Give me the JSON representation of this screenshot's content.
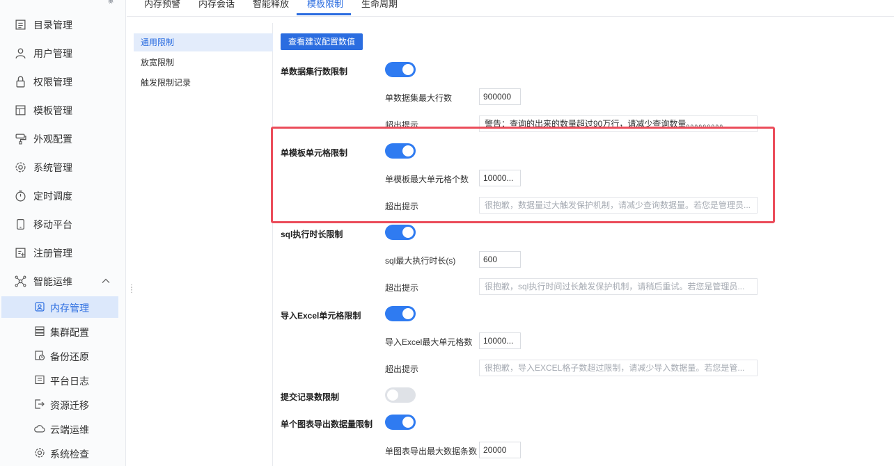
{
  "sidebar": {
    "items": [
      {
        "label": "目录管理",
        "icon": "catalog-icon"
      },
      {
        "label": "用户管理",
        "icon": "user-icon"
      },
      {
        "label": "权限管理",
        "icon": "lock-icon"
      },
      {
        "label": "模板管理",
        "icon": "template-icon"
      },
      {
        "label": "外观配置",
        "icon": "paint-roller-icon"
      },
      {
        "label": "系统管理",
        "icon": "gear-icon"
      },
      {
        "label": "定时调度",
        "icon": "timer-icon"
      },
      {
        "label": "移动平台",
        "icon": "mobile-icon"
      },
      {
        "label": "注册管理",
        "icon": "register-icon"
      },
      {
        "label": "智能运维",
        "icon": "network-icon"
      }
    ],
    "sub_items": [
      {
        "label": "内存管理",
        "icon": "memory-icon",
        "active": true
      },
      {
        "label": "集群配置",
        "icon": "cluster-icon"
      },
      {
        "label": "备份还原",
        "icon": "backup-icon"
      },
      {
        "label": "平台日志",
        "icon": "log-icon"
      },
      {
        "label": "资源迁移",
        "icon": "migrate-icon"
      },
      {
        "label": "云端运维",
        "icon": "cloud-icon"
      },
      {
        "label": "系统检查",
        "icon": "check-icon"
      }
    ]
  },
  "tabs": [
    {
      "label": "内存预警"
    },
    {
      "label": "内存会话"
    },
    {
      "label": "智能释放"
    },
    {
      "label": "模板限制",
      "active": true
    },
    {
      "label": "生命周期"
    }
  ],
  "subnav": [
    {
      "label": "通用限制",
      "active": true
    },
    {
      "label": "放宽限制"
    },
    {
      "label": "触发限制记录"
    }
  ],
  "content": {
    "view_button": "查看建议配置数值",
    "sections": [
      {
        "label": "单数据集行数限制",
        "enabled": true,
        "limit_label": "单数据集最大行数",
        "limit_value": "900000",
        "tip_label": "超出提示",
        "tip_value": "警告：查询的出来的数量超过90万行，请减少查询数量。。。。。。。。。"
      },
      {
        "label": "单模板单元格限制",
        "enabled": true,
        "limit_label": "单模板最大单元格个数",
        "limit_value": "10000...",
        "tip_label": "超出提示",
        "tip_placeholder": "很抱歉，数据量过大触发保护机制，请减少查询数据量。若您是管理员..."
      },
      {
        "label": "sql执行时长限制",
        "enabled": true,
        "limit_label": "sql最大执行时长(s)",
        "limit_value": "600",
        "tip_label": "超出提示",
        "tip_placeholder": "很抱歉，sql执行时间过长触发保护机制，请稍后重试。若您是管理员..."
      },
      {
        "label": "导入Excel单元格限制",
        "enabled": true,
        "limit_label": "导入Excel最大单元格数",
        "limit_value": "10000...",
        "tip_label": "超出提示",
        "tip_placeholder": "很抱歉，导入EXCEL格子数超过限制，请减少导入数据量。若您是管..."
      },
      {
        "label": "提交记录数限制",
        "enabled": false
      },
      {
        "label": "单个图表导出数据量限制",
        "enabled": true,
        "limit_label": "单图表导出最大数据条数",
        "limit_value": "20000"
      }
    ]
  },
  "colors": {
    "accent": "#2b6de0",
    "toggle_on": "#2f7bf1",
    "highlight": "#eb4c5a"
  }
}
